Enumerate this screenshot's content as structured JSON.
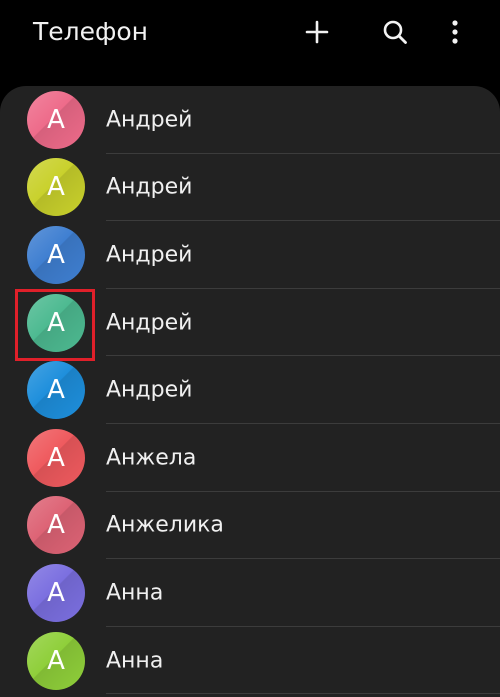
{
  "header": {
    "title": "Телефон",
    "actions": [
      {
        "icon": "plus-icon",
        "name": "add-contact-button"
      },
      {
        "icon": "search-icon",
        "name": "search-button"
      },
      {
        "icon": "more-vertical-icon",
        "name": "more-options-button"
      }
    ]
  },
  "contacts": [
    {
      "name": "Андрей",
      "initial": "А",
      "color": "#ee6b8a"
    },
    {
      "name": "Андрей",
      "initial": "А",
      "color": "#c9d12c"
    },
    {
      "name": "Андрей",
      "initial": "А",
      "color": "#3f7fd1"
    },
    {
      "name": "Андрей",
      "initial": "А",
      "color": "#4dba91"
    },
    {
      "name": "Андрей",
      "initial": "А",
      "color": "#1e8fdc"
    },
    {
      "name": "Анжела",
      "initial": "А",
      "color": "#ef5a5e"
    },
    {
      "name": "Анжелика",
      "initial": "А",
      "color": "#dd6375"
    },
    {
      "name": "Анна",
      "initial": "А",
      "color": "#7b6fe0"
    },
    {
      "name": "Анна",
      "initial": "А",
      "color": "#8fcf3a"
    }
  ],
  "highlight": {
    "color": "#e0202a",
    "contact_index": 3
  }
}
